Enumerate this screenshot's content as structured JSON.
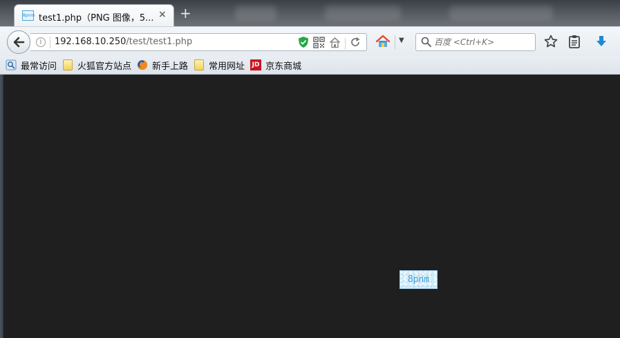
{
  "tab": {
    "favicon_text": "8pnm",
    "title": "test1.php（PNG 图像，5...",
    "close_glyph": "×",
    "new_tab_glyph": "+"
  },
  "address_bar": {
    "host": "192.168.10.250",
    "path": "/test/test1.php",
    "info_glyph": "i"
  },
  "search": {
    "placeholder": "百度 <Ctrl+K>"
  },
  "bookmarks": [
    {
      "label": "最常访问",
      "icon": "most-visited-icon"
    },
    {
      "label": "火狐官方站点",
      "icon": "folder-icon"
    },
    {
      "label": "新手上路",
      "icon": "firefox-icon"
    },
    {
      "label": "常用网址",
      "icon": "folder-icon"
    },
    {
      "label": "京东商城",
      "icon": "jd-icon"
    }
  ],
  "jd_icon_text": "JD",
  "captcha": {
    "text": "8pnm"
  },
  "colors": {
    "page_background": "#1f1f1f",
    "captcha_background": "#cfeaf8",
    "captcha_text": "#3da3dc",
    "security_shield": "#27a745",
    "download_arrow": "#1e8ad6"
  }
}
